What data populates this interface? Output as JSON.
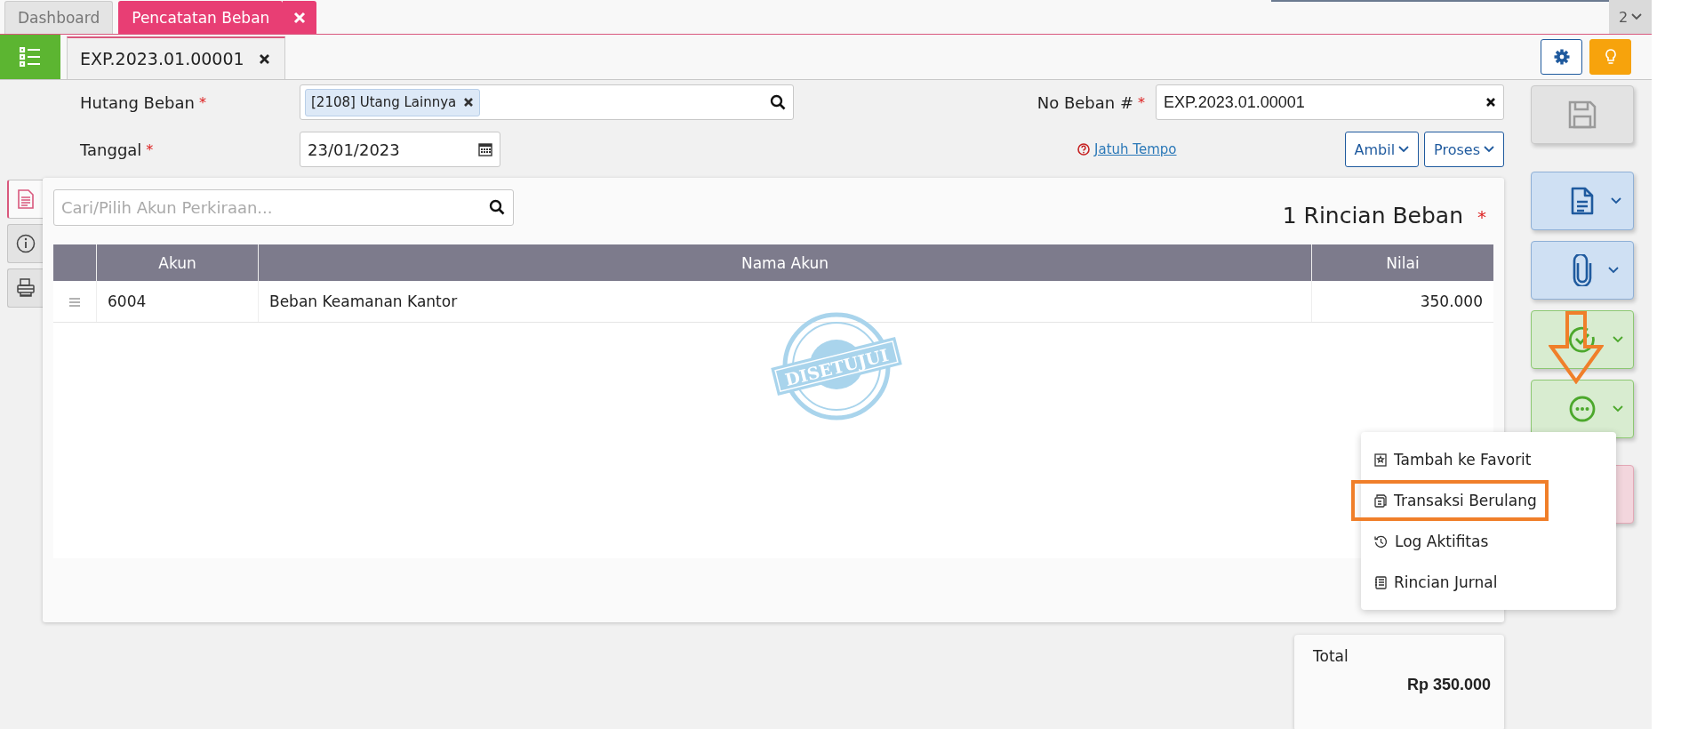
{
  "app_tabs": [
    {
      "label": "Dashboard",
      "selected": false
    },
    {
      "label": "Pencatatan Beban",
      "selected": true
    }
  ],
  "tab_count": "2",
  "doc_tabs": [
    {
      "label": "EXP.2023.01.00001",
      "selected": true
    }
  ],
  "form": {
    "hutang_beban": {
      "label": "Hutang Beban",
      "required_mark": "*",
      "chips": [
        "[2108] Utang Lainnya"
      ]
    },
    "no_beban": {
      "label": "No Beban #",
      "required_mark": "*",
      "value": "EXP.2023.01.00001"
    },
    "tanggal": {
      "label": "Tanggal",
      "required_mark": "*",
      "value": "23/01/2023"
    },
    "jatuh_tempo_link": "Jatuh Tempo",
    "buttons": [
      "Ambil",
      "Proses"
    ]
  },
  "side_tabs": [
    {
      "kind": "document",
      "selected": true
    },
    {
      "kind": "info",
      "selected": false
    },
    {
      "kind": "printer",
      "selected": false
    }
  ],
  "details": {
    "search_placeholder": "Cari/Pilih Akun Perkiraan...",
    "title": "1 Rincian Beban",
    "required_mark": "*",
    "columns": [
      "Akun",
      "Nama Akun",
      "Nilai"
    ],
    "rows": [
      {
        "akun": "6004",
        "nama_akun": "Beban Keamanan Kantor",
        "nilai": "350.000"
      }
    ],
    "stamp": "DISETUJUI"
  },
  "total": {
    "label": "Total",
    "value": "Rp 350.000"
  },
  "actions": [
    {
      "kind": "save"
    },
    {
      "kind": "document"
    },
    {
      "kind": "attach"
    },
    {
      "kind": "approve"
    },
    {
      "kind": "more",
      "expanded": true
    },
    {
      "kind": "delete"
    }
  ],
  "menu": [
    {
      "kind": "favorite",
      "label": "Tambah ke Favorit",
      "highlighted": false
    },
    {
      "kind": "recurring",
      "label": "Transaksi Berulang",
      "highlighted": true
    },
    {
      "kind": "log",
      "label": "Log Aktifitas",
      "highlighted": false
    },
    {
      "kind": "journal",
      "label": "Rincian Jurnal",
      "highlighted": false
    }
  ]
}
